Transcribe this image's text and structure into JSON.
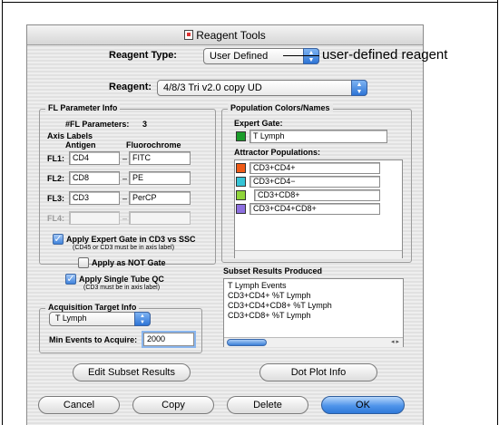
{
  "window": {
    "title": "Reagent Tools"
  },
  "reagent_type": {
    "label": "Reagent Type:",
    "value": "User Defined"
  },
  "annotation": {
    "text": "user-defined reagent"
  },
  "reagent": {
    "label": "Reagent:",
    "value": "4/8/3 Tri v2.0 copy UD"
  },
  "fl_info": {
    "title": "FL Parameter Info",
    "count_label": "#FL Parameters:",
    "count_value": "3",
    "axis_labels": "Axis Labels",
    "col_antigen": "Antigen",
    "col_fluoro": "Fluorochrome",
    "rows": [
      {
        "label": "FL1:",
        "antigen": "CD4",
        "fluoro": "FITC"
      },
      {
        "label": "FL2:",
        "antigen": "CD8",
        "fluoro": "PE"
      },
      {
        "label": "FL3:",
        "antigen": "CD3",
        "fluoro": "PerCP"
      },
      {
        "label": "FL4:",
        "antigen": "",
        "fluoro": ""
      }
    ],
    "dash": "–"
  },
  "options": {
    "expert_gate": {
      "label": "Apply Expert Gate in CD3 vs SSC",
      "note": "(CD45 or CD3 must be in axis label)",
      "checked": true
    },
    "not_gate": {
      "label": "Apply as NOT Gate",
      "checked": false
    },
    "single_tube": {
      "label": "Apply Single Tube QC",
      "note": "(CD3 must be in axis label)",
      "checked": true
    }
  },
  "acquisition": {
    "title": "Acquisition Target Info",
    "target": "T Lymph",
    "min_label": "Min Events to Acquire:",
    "min_value": "2000"
  },
  "population": {
    "title": "Population Colors/Names",
    "expert_gate_label": "Expert Gate:",
    "expert_gate_name": "T Lymph",
    "expert_gate_color": "#1a9c2a",
    "attractor_label": "Attractor Populations:",
    "attractors": [
      {
        "name": "CD3+CD4+",
        "color": "#ef5a16"
      },
      {
        "name": "CD3+CD4−",
        "color": "#35c4d6"
      },
      {
        "name": "CD3+CD8+",
        "color": "#8fd43a"
      },
      {
        "name": "CD3+CD4+CD8+",
        "color": "#8d6fe0"
      }
    ]
  },
  "subset_results": {
    "title": "Subset Results Produced",
    "items": [
      "T Lymph Events",
      "CD3+CD4+ %T Lymph",
      "CD3+CD4+CD8+ %T Lymph",
      "CD3+CD8+ %T Lymph"
    ]
  },
  "buttons": {
    "edit_subset": "Edit Subset Results",
    "dot_plot": "Dot Plot Info",
    "cancel": "Cancel",
    "copy": "Copy",
    "delete": "Delete",
    "ok": "OK"
  }
}
